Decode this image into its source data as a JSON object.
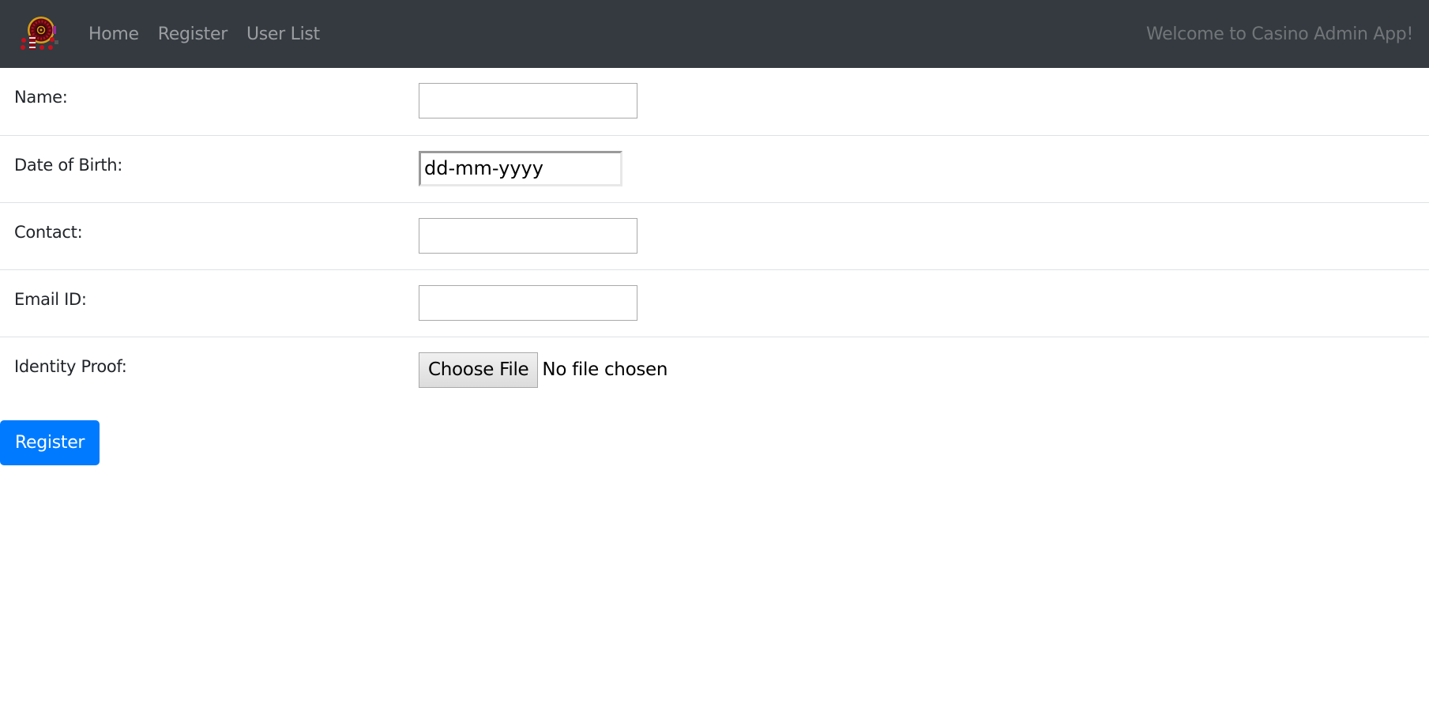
{
  "navbar": {
    "logo_icon": "casino-roulette-logo",
    "links": [
      {
        "label": "Home"
      },
      {
        "label": "Register"
      },
      {
        "label": "User List"
      }
    ],
    "welcome_text": "Welcome to Casino Admin App!"
  },
  "form": {
    "fields": [
      {
        "label": "Name:",
        "type": "text",
        "value": ""
      },
      {
        "label": "Date of Birth:",
        "type": "date",
        "placeholder": "dd-mm-yyyy",
        "value": ""
      },
      {
        "label": "Contact:",
        "type": "text",
        "value": ""
      },
      {
        "label": "Email ID:",
        "type": "text",
        "value": ""
      },
      {
        "label": "Identity Proof:",
        "type": "file",
        "button_label": "Choose File",
        "status": "No file chosen"
      }
    ],
    "submit_label": "Register"
  },
  "colors": {
    "navbar_bg": "#343a40",
    "primary": "#007bff",
    "divider": "#dee2e6"
  }
}
